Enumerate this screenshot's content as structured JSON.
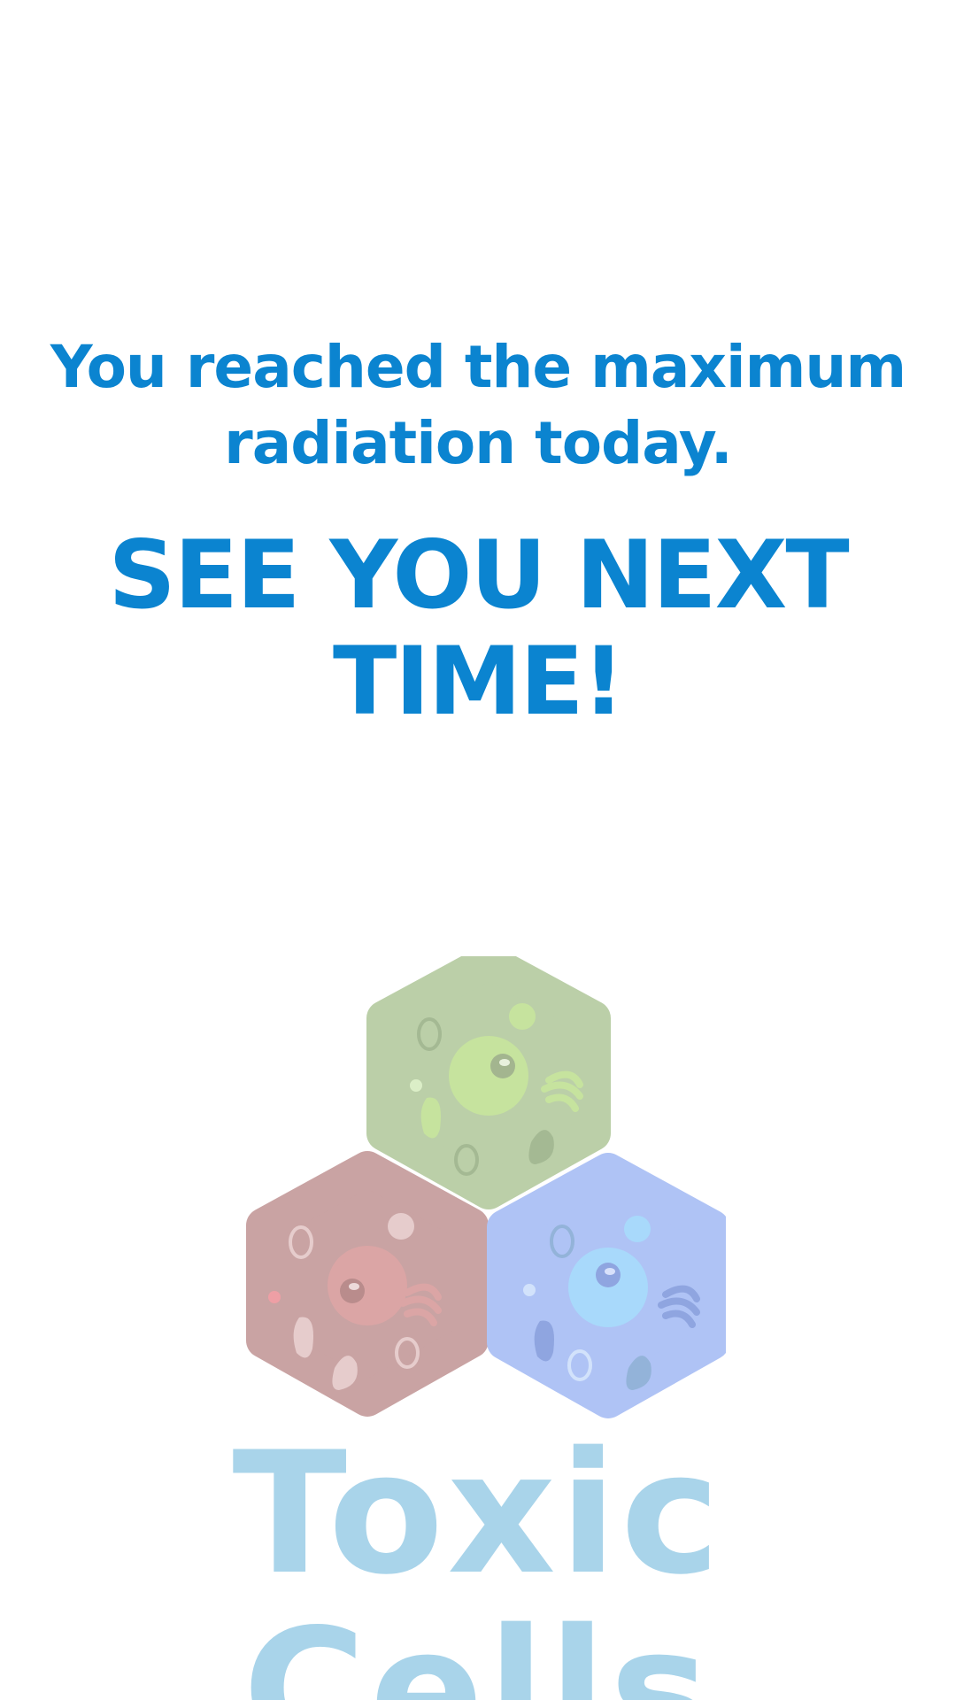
{
  "message": {
    "line1": "You reached the maximum",
    "line2": "radiation today."
  },
  "headline": "SEE YOU NEXT TIME!",
  "logo": {
    "icon": "toxic-cells-logo-icon",
    "cells": [
      {
        "name": "green-cell",
        "color": "#bbcfa8",
        "nucleus": "#c6e39e"
      },
      {
        "name": "red-cell",
        "color": "#c9a3a3",
        "nucleus": "#dba5a5"
      },
      {
        "name": "blue-cell",
        "color": "#afc3f5",
        "nucleus": "#a8d9fb"
      }
    ]
  },
  "title": "Toxic Cells",
  "colors": {
    "text_primary": "#0b84d0",
    "title": "#a9d4ea",
    "background": "#ffffff"
  }
}
